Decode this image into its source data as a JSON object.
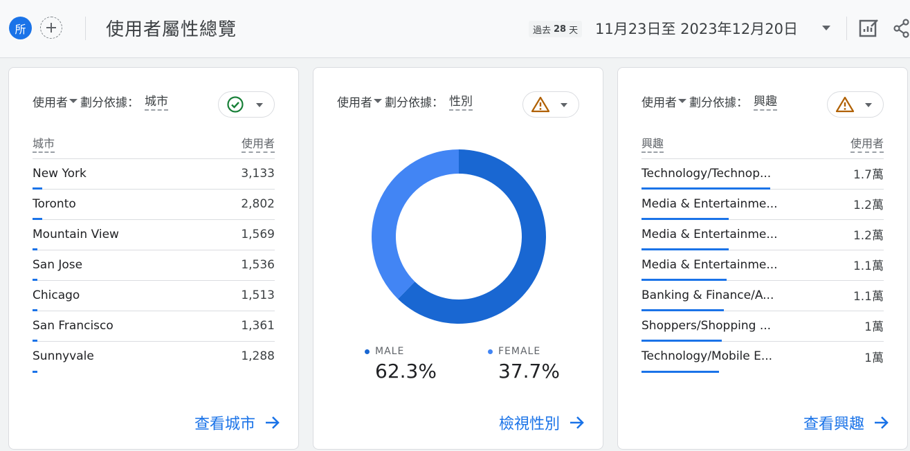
{
  "header": {
    "avatar_letter": "所",
    "title": "使用者屬性總覽",
    "range_prefix": "過去",
    "range_days": "28",
    "range_suffix": "天",
    "date_range": "11月23日至 2023年12月20日"
  },
  "colors": {
    "accent": "#1a73e8",
    "donut_primary": "#1967d2",
    "donut_secondary": "#4285f4",
    "ok": "#188038",
    "warn": "#b06000"
  },
  "metric_label": "使用者",
  "split_label": "劃分依據：",
  "cards": [
    {
      "dimension": "城市",
      "status": "ok",
      "col_dimension": "城市",
      "col_metric": "使用者",
      "rows": [
        {
          "label": "New York",
          "value": "3,133",
          "fraction": 0.04
        },
        {
          "label": "Toronto",
          "value": "2,802",
          "fraction": 0.04
        },
        {
          "label": "Mountain View",
          "value": "1,569",
          "fraction": 0.02
        },
        {
          "label": "San Jose",
          "value": "1,536",
          "fraction": 0.02
        },
        {
          "label": "Chicago",
          "value": "1,513",
          "fraction": 0.02
        },
        {
          "label": "San Francisco",
          "value": "1,361",
          "fraction": 0.02
        },
        {
          "label": "Sunnyvale",
          "value": "1,288",
          "fraction": 0.02
        }
      ],
      "link": "查看城市"
    },
    {
      "dimension": "性別",
      "status": "warning",
      "segments": [
        {
          "label": "MALE",
          "percent": "62.3%",
          "value": 62.3,
          "color": "#1967d2"
        },
        {
          "label": "FEMALE",
          "percent": "37.7%",
          "value": 37.7,
          "color": "#4285f4"
        }
      ],
      "link": "檢視性別"
    },
    {
      "dimension": "興趣",
      "status": "warning",
      "col_dimension": "興趣",
      "col_metric": "使用者",
      "rows": [
        {
          "label": "Technology/Technop...",
          "value": "1.7萬",
          "fraction": 0.53
        },
        {
          "label": "Media & Entertainme...",
          "value": "1.2萬",
          "fraction": 0.36
        },
        {
          "label": "Media & Entertainme...",
          "value": "1.2萬",
          "fraction": 0.36
        },
        {
          "label": "Media & Entertainme...",
          "value": "1.1萬",
          "fraction": 0.35
        },
        {
          "label": "Banking & Finance/A...",
          "value": "1.1萬",
          "fraction": 0.34
        },
        {
          "label": "Shoppers/Shopping ...",
          "value": "1萬",
          "fraction": 0.33
        },
        {
          "label": "Technology/Mobile E...",
          "value": "1萬",
          "fraction": 0.32
        }
      ],
      "link": "查看興趣"
    }
  ]
}
